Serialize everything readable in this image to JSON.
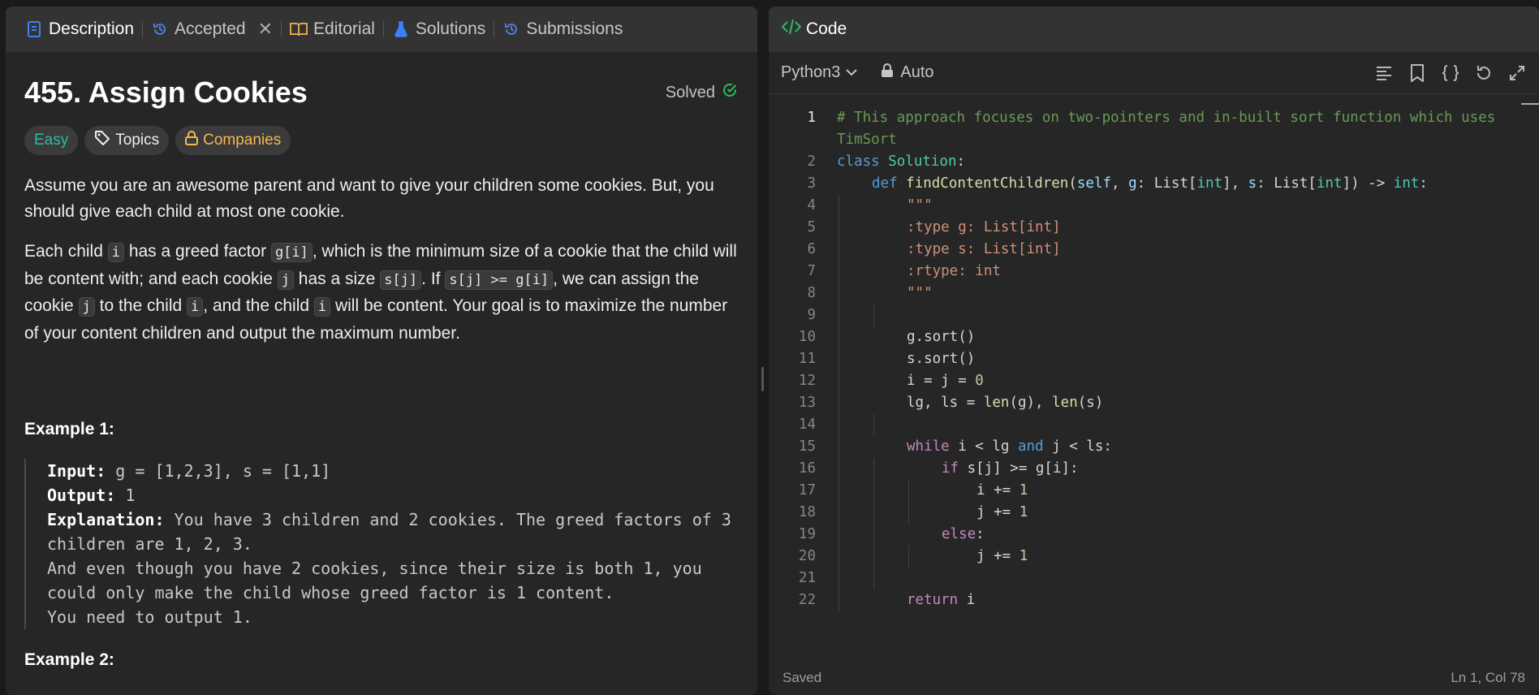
{
  "tabs": [
    {
      "label": "Description",
      "icon": "description-icon"
    },
    {
      "label": "Accepted",
      "icon": "history-icon"
    },
    {
      "label": "Editorial",
      "icon": "book-icon"
    },
    {
      "label": "Solutions",
      "icon": "flask-icon"
    },
    {
      "label": "Submissions",
      "icon": "history-icon"
    }
  ],
  "problem": {
    "title": "455. Assign Cookies",
    "status": "Solved",
    "tags": {
      "difficulty": "Easy",
      "topics": "Topics",
      "companies": "Companies"
    },
    "para1": "Assume you are an awesome parent and want to give your children some cookies. But, you should give each child at most one cookie.",
    "para2": {
      "t1": "Each child ",
      "c1": "i",
      "t2": " has a greed factor ",
      "c2": "g[i]",
      "t3": ", which is the minimum size of a cookie that the child will be content with; and each cookie ",
      "c3": "j",
      "t4": " has a size ",
      "c4": "s[j]",
      "t5": ". If ",
      "c5": "s[j] >= g[i]",
      "t6": ", we can assign the cookie ",
      "c6": "j",
      "t7": " to the child ",
      "c7": "i",
      "t8": ", and the child ",
      "c8": "i",
      "t9": " will be content. Your goal is to maximize the number of your content children and output the maximum number."
    },
    "example1": {
      "heading": "Example 1:",
      "input_label": "Input:",
      "input": " g = [1,2,3], s = [1,1]",
      "output_label": "Output:",
      "output": " 1",
      "explanation_label": "Explanation:",
      "explanation": " You have 3 children and 2 cookies. The greed factors of 3 children are 1, 2, 3. \nAnd even though you have 2 cookies, since their size is both 1, you could only make the child whose greed factor is 1 content.\nYou need to output 1."
    },
    "example2_heading": "Example 2:"
  },
  "editor": {
    "panel_title": "Code",
    "language": "Python3",
    "mode": "Auto",
    "status_left": "Saved",
    "status_right": "Ln 1, Col 78",
    "lines": [
      {
        "n": "1",
        "indent": 0,
        "tokens": [
          [
            "cmt",
            "# This approach focuses on two-pointers and in-built sort function which uses"
          ]
        ]
      },
      {
        "n": "",
        "indent": 0,
        "tokens": [
          [
            "cmt",
            "TimSort"
          ]
        ]
      },
      {
        "n": "2",
        "indent": 0,
        "tokens": [
          [
            "kw",
            "class "
          ],
          [
            "cls",
            "Solution"
          ],
          [
            "",
            ":"
          ]
        ]
      },
      {
        "n": "3",
        "indent": 1,
        "tokens": [
          [
            "kw",
            "def "
          ],
          [
            "fn",
            "findContentChildren"
          ],
          [
            "",
            "("
          ],
          [
            "par",
            "self"
          ],
          [
            "",
            ", "
          ],
          [
            "par",
            "g"
          ],
          [
            "",
            ": List["
          ],
          [
            "cls",
            "int"
          ],
          [
            "",
            "], "
          ],
          [
            "par",
            "s"
          ],
          [
            "",
            ": List["
          ],
          [
            "cls",
            "int"
          ],
          [
            "",
            "]) -> "
          ],
          [
            "cls",
            "int"
          ],
          [
            "",
            ":"
          ]
        ]
      },
      {
        "n": "4",
        "indent": 2,
        "tokens": [
          [
            "str",
            "\"\"\""
          ]
        ]
      },
      {
        "n": "5",
        "indent": 2,
        "tokens": [
          [
            "str",
            ":type g: List[int]"
          ]
        ]
      },
      {
        "n": "6",
        "indent": 2,
        "tokens": [
          [
            "str",
            ":type s: List[int]"
          ]
        ]
      },
      {
        "n": "7",
        "indent": 2,
        "tokens": [
          [
            "str",
            ":rtype: int"
          ]
        ]
      },
      {
        "n": "8",
        "indent": 2,
        "tokens": [
          [
            "str",
            "\"\"\""
          ]
        ]
      },
      {
        "n": "9",
        "indent": 0,
        "tokens": []
      },
      {
        "n": "10",
        "indent": 2,
        "tokens": [
          [
            "",
            "g.sort()"
          ]
        ]
      },
      {
        "n": "11",
        "indent": 2,
        "tokens": [
          [
            "",
            "s.sort()"
          ]
        ]
      },
      {
        "n": "12",
        "indent": 2,
        "tokens": [
          [
            "",
            "i = j = "
          ],
          [
            "num",
            "0"
          ]
        ]
      },
      {
        "n": "13",
        "indent": 2,
        "tokens": [
          [
            "",
            "lg, ls = "
          ],
          [
            "fn",
            "len"
          ],
          [
            "",
            "(g), "
          ],
          [
            "fn",
            "len"
          ],
          [
            "",
            "(s)"
          ]
        ]
      },
      {
        "n": "14",
        "indent": 0,
        "tokens": []
      },
      {
        "n": "15",
        "indent": 2,
        "tokens": [
          [
            "ctl",
            "while "
          ],
          [
            "",
            "i < lg "
          ],
          [
            "kw",
            "and "
          ],
          [
            "",
            "j < ls:"
          ]
        ]
      },
      {
        "n": "16",
        "indent": 3,
        "tokens": [
          [
            "ctl",
            "if "
          ],
          [
            "",
            "s[j] >= g[i]:"
          ]
        ]
      },
      {
        "n": "17",
        "indent": 4,
        "tokens": [
          [
            "",
            "i += "
          ],
          [
            "num",
            "1"
          ]
        ]
      },
      {
        "n": "18",
        "indent": 4,
        "tokens": [
          [
            "",
            "j += "
          ],
          [
            "num",
            "1"
          ]
        ]
      },
      {
        "n": "19",
        "indent": 3,
        "tokens": [
          [
            "ctl",
            "else"
          ],
          [
            "",
            ":"
          ]
        ]
      },
      {
        "n": "20",
        "indent": 4,
        "tokens": [
          [
            "",
            "j += "
          ],
          [
            "num",
            "1"
          ]
        ]
      },
      {
        "n": "21",
        "indent": 0,
        "tokens": []
      },
      {
        "n": "22",
        "indent": 2,
        "tokens": [
          [
            "ctl",
            "return "
          ],
          [
            "",
            "i"
          ]
        ]
      }
    ]
  }
}
